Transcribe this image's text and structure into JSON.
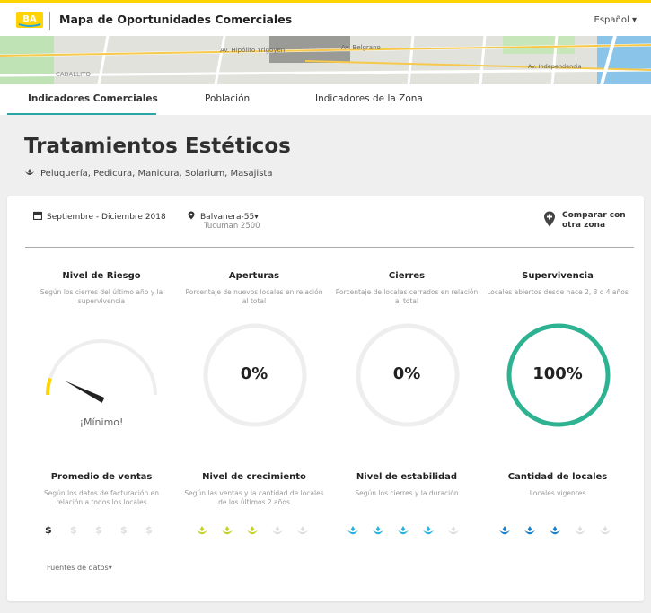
{
  "header": {
    "logo_text": "BA",
    "title": "Mapa de Oportunidades Comerciales",
    "language": "Español",
    "language_caret": "▾"
  },
  "map": {
    "labels": [
      "Av. Hipólito Yrigoyen",
      "Av. Belgrano",
      "CABALLITO",
      "Av. Independencia"
    ]
  },
  "tabs": [
    {
      "label": "Indicadores Comerciales",
      "active": true
    },
    {
      "label": "Población",
      "active": false
    },
    {
      "label": "Indicadores de la Zona",
      "active": false
    }
  ],
  "page": {
    "title": "Tratamientos Estéticos",
    "subtitle": "Peluquería, Pedicura, Manicura, Solarium, Masajista"
  },
  "filters": {
    "period": "Septiembre - Diciembre 2018",
    "zone": "Balvanera-55",
    "zone_caret": "▾",
    "address": "Tucuman 2500",
    "compare": "Comparar con otra zona"
  },
  "metrics_top": [
    {
      "title": "Nivel de Riesgo",
      "desc": "Según los cierres del último año y la supervivencia",
      "gauge_label": "¡Mínimo!",
      "level": 0.1
    },
    {
      "title": "Aperturas",
      "desc": "Porcentaje de nuevos locales en relación al total",
      "value": "0%",
      "percent": 0
    },
    {
      "title": "Cierres",
      "desc": "Porcentaje de locales cerrados en relación al total",
      "value": "0%",
      "percent": 0
    },
    {
      "title": "Supervivencia",
      "desc": "Locales abiertos desde hace 2, 3 o 4 años",
      "value": "100%",
      "percent": 100
    }
  ],
  "metrics_bottom": [
    {
      "title": "Promedio de ventas",
      "desc": "Según los datos de facturación en relación a todos los locales",
      "symbol": "$",
      "filled": 1,
      "total": 5,
      "color": "#222222"
    },
    {
      "title": "Nivel de crecimiento",
      "desc": "Según las ventas y la cantidad de locales de los últimos 2 años",
      "filled": 3,
      "total": 5,
      "color": "#c5d12a"
    },
    {
      "title": "Nivel de estabilidad",
      "desc": "Según los cierres y la duración",
      "filled": 4,
      "total": 5,
      "color": "#2ab3dd"
    },
    {
      "title": "Cantidad de locales",
      "desc": "Locales vigentes",
      "filled": 3,
      "total": 5,
      "color": "#1a7fc6"
    }
  ],
  "footer": {
    "sources": "Fuentes de datos",
    "sources_caret": "▾"
  },
  "colors": {
    "brand_yellow": "#ffd400",
    "tab_accent": "#2aa6a6",
    "survival_ring": "#2db391",
    "ring_empty": "#eeeeee",
    "inactive_icon": "#dddddd"
  }
}
